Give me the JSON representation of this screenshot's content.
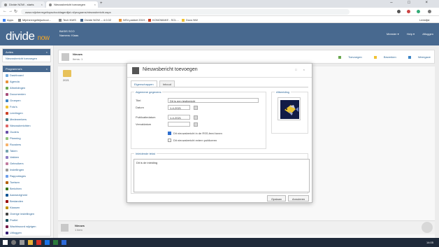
{
  "browser": {
    "tabs": [
      {
        "label": "Divide NOW - starts"
      },
      {
        "label": "Nieuwsbericht toevoegen"
      }
    ],
    "new_tab_symbol": "+",
    "window_controls": "– □ ×",
    "url": "www.mijnherregeliopschooldagenlijst.nl/programs/nieuwsbericht.aspx",
    "bookmarks": [
      {
        "label": "Apps"
      },
      {
        "label": "Mijnherregelbijschool..."
      },
      {
        "label": "Tech NWS"
      },
      {
        "label": "Divide NOW -- 4.0.02"
      },
      {
        "label": "NSV-pakket 2019 - ..."
      },
      {
        "label": "KONOMAKE - SCL..."
      },
      {
        "label": "Docs NW"
      }
    ],
    "bookmarks_overflow": "Leeslijst"
  },
  "app": {
    "logo": "divide",
    "logo_suffix": "now",
    "school_name": "BASIS SCO",
    "school_sub": "Namens: Klaas",
    "header_links": [
      "Meester ▾",
      "Help ▾",
      "Afloggen"
    ]
  },
  "sidebar": {
    "box1": {
      "title": "Acties",
      "items": [
        "Nieuwsbericht toevoegen"
      ]
    },
    "box2": {
      "title": "Programma's",
      "items": [
        {
          "label": "Dashboard",
          "color": "#6fa8dc"
        },
        {
          "label": "Agenda",
          "color": "#e69138"
        },
        {
          "label": "Afmeldingen",
          "color": "#6aa84f"
        },
        {
          "label": "Documenten",
          "color": "#a64d79"
        },
        {
          "label": "Groepen",
          "color": "#3d85c6"
        },
        {
          "label": "Foto's",
          "color": "#f1c232"
        },
        {
          "label": "Leerlingen",
          "color": "#cc4125"
        },
        {
          "label": "Medewerkers",
          "color": "#45818e"
        },
        {
          "label": "Nieuwsberichten",
          "color": "#e06666"
        },
        {
          "label": "Ouders",
          "color": "#674ea7"
        },
        {
          "label": "Planning",
          "color": "#93c47d"
        },
        {
          "label": "Roosters",
          "color": "#f6b26b"
        },
        {
          "label": "Taken",
          "color": "#76a5af"
        },
        {
          "label": "Vakken",
          "color": "#8e7cc3"
        },
        {
          "label": "Gebruikers",
          "color": "#c27ba0"
        },
        {
          "label": "Instellingen",
          "color": "#999999"
        },
        {
          "label": "Rapportages",
          "color": "#6d9eeb"
        },
        {
          "label": "Toetsen",
          "color": "#b45f06"
        },
        {
          "label": "Berichten",
          "color": "#38761d"
        },
        {
          "label": "Aanwezigheid",
          "color": "#0b5394"
        },
        {
          "label": "Bestanden",
          "color": "#990000"
        },
        {
          "label": "Klassen",
          "color": "#bf9000"
        },
        {
          "label": "Overige instellingen",
          "color": "#434343"
        },
        {
          "label": "Profiel",
          "color": "#134f5c"
        },
        {
          "label": "Wachtwoord wijzigen",
          "color": "#741b47"
        },
        {
          "label": "Uitloggen",
          "color": "#351c75"
        }
      ]
    }
  },
  "main": {
    "title": "Nieuws",
    "subtitle": "Items: 1",
    "actions": [
      {
        "label": "Toevoegen",
        "color": "#6aa84f"
      },
      {
        "label": "Bewerken",
        "color": "#f1c232"
      },
      {
        "label": "Weergave",
        "color": "#3d85c6"
      }
    ],
    "folder_label": "2021",
    "footer_title": "Nieuws",
    "footer_sub": "1 item"
  },
  "dialog": {
    "title": "Nieuwsbericht toevoegen",
    "controls": "□ ×",
    "tabs": [
      "Eigenschappen",
      "Inhoud"
    ],
    "general_legend": "Algemene gegevens",
    "fields": {
      "title_label": "Titel",
      "title_value": "Dit is een testbericht",
      "date_label": "Datum",
      "date_value": "1-4-2021",
      "publish_label": "Publicatiedatum",
      "publish_value": "1-4-2021",
      "expire_label": "Vervaldatum",
      "expire_value": ""
    },
    "checkboxes": [
      {
        "label": "Dit nieuwsbericht in de RSS-feed tonen",
        "checked": true
      },
      {
        "label": "Dit nieuwsbericht extern publiceren",
        "checked": false
      }
    ],
    "image_legend": "Afbeelding",
    "intro_legend": "Inleidende tekst",
    "intro_value": "Dit is de inleiding",
    "buttons": {
      "save": "Opslaan",
      "cancel": "Annuleren"
    }
  },
  "taskbar": {
    "clock": "14:05"
  }
}
